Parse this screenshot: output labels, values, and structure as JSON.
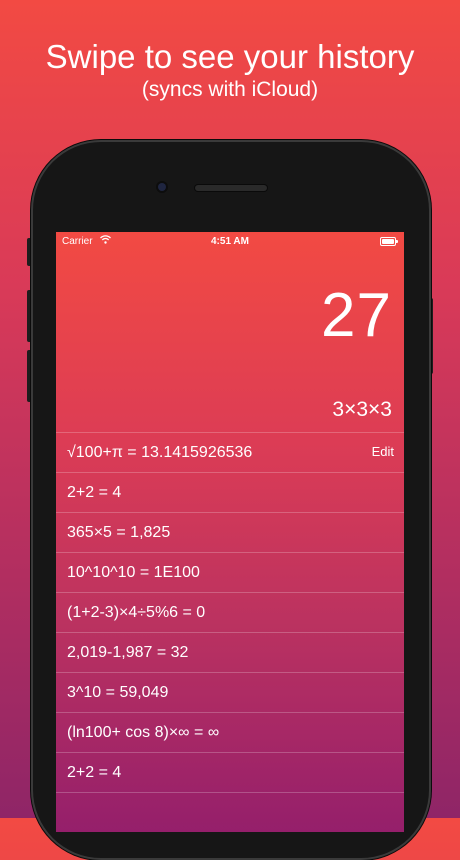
{
  "headline": {
    "title": "Swipe to see your history",
    "subtitle": "(syncs with iCloud)"
  },
  "status_bar": {
    "carrier": "Carrier",
    "time": "4:51 AM"
  },
  "calculator": {
    "result": "27",
    "expression": "3×3×3"
  },
  "history": {
    "edit_label": "Edit",
    "entries": [
      "√100+π = 13.1415926536",
      "2+2 = 4",
      "365×5 = 1,825",
      "10^10^10 = 1E100",
      "(1+2-3)×4÷5%6 = 0",
      "2,019-1,987 = 32",
      "3^10 = 59,049",
      "(ln100+ cos 8)×∞ = ∞",
      "2+2 = 4"
    ]
  },
  "colors": {
    "gradient_top": "#f24a43",
    "gradient_bottom": "#8f2567",
    "phone_body": "#161616"
  }
}
